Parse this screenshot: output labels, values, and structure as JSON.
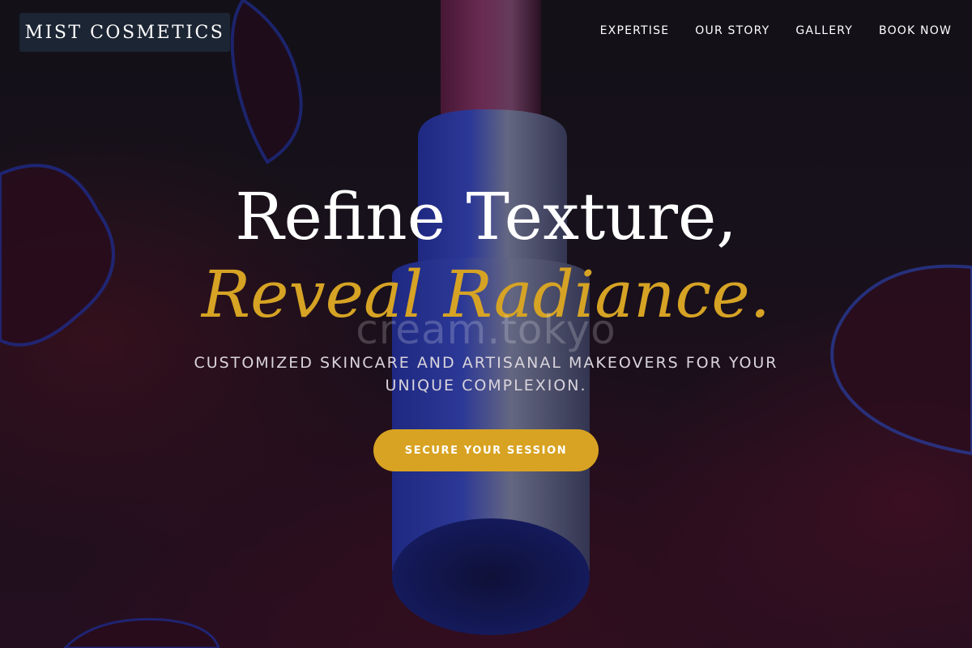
{
  "brand": {
    "name": "MIST COSMETICS"
  },
  "nav": {
    "items": [
      {
        "label": "EXPERTISE"
      },
      {
        "label": "OUR STORY"
      },
      {
        "label": "GALLERY"
      },
      {
        "label": "BOOK NOW"
      }
    ]
  },
  "hero": {
    "headline_line1": "Refine Texture,",
    "headline_line2": "Reveal Radiance.",
    "watermark": "cream.tokyo",
    "subtitle": "CUSTOMIZED SKINCARE AND ARTISANAL MAKEOVERS FOR YOUR UNIQUE COMPLEXION.",
    "cta_label": "SECURE YOUR SESSION",
    "background_image": "lipstick-product-photo"
  },
  "colors": {
    "accent": "#d8a322",
    "brand_bg": "#1c2533",
    "headline": "#ffffff",
    "subtitle": "#d9d4dc"
  }
}
